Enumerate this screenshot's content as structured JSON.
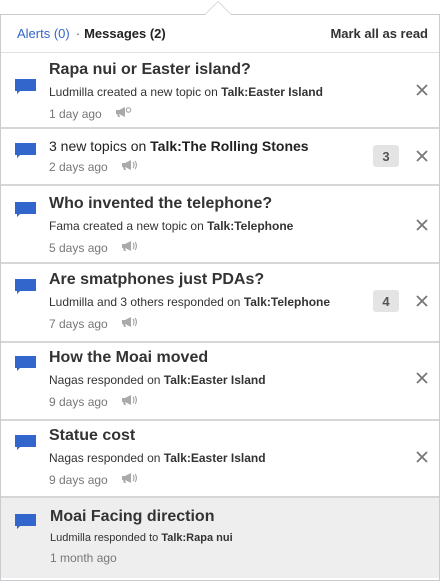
{
  "header": {
    "alerts_label": "Alerts (0)",
    "separator": "·",
    "messages_label": "Messages (2)",
    "mark_all_label": "Mark all as read"
  },
  "colors": {
    "accent": "#3366cc",
    "read_bg": "#eeeeee",
    "bubble": "#3366cc"
  },
  "items": [
    {
      "title": "Rapa nui or Easter island?",
      "actor": "Ludmilla",
      "action": " created a new topic on ",
      "target": "Talk:Easter Island",
      "time": "1 day ago"
    },
    {
      "title_prefix": "3 new topics on ",
      "title_target": "Talk:The Rolling Stones",
      "count": "3",
      "time": "2 days ago"
    },
    {
      "title": "Who invented the telephone?",
      "actor": "Fama",
      "action": " created a new topic on ",
      "target": "Talk:Telephone",
      "time": "5 days ago"
    },
    {
      "title": "Are smatphones just PDAs?",
      "actor": "Ludmilla and 3 others",
      "action": " responded on ",
      "target": "Talk:Telephone",
      "count": "4",
      "time": "7 days ago"
    },
    {
      "title": "How the Moai moved",
      "actor": "Nagas",
      "action": " responded on ",
      "target": "Talk:Easter Island",
      "time": "9 days ago"
    },
    {
      "title": "Statue cost",
      "actor": "Nagas",
      "action": " responded on ",
      "target": "Talk:Easter Island",
      "time": "9 days ago"
    },
    {
      "title": "Moai Facing direction",
      "actor": "Ludmilla",
      "action": " responded to ",
      "target": "Talk:Rapa nui",
      "time": "1 month ago"
    }
  ]
}
